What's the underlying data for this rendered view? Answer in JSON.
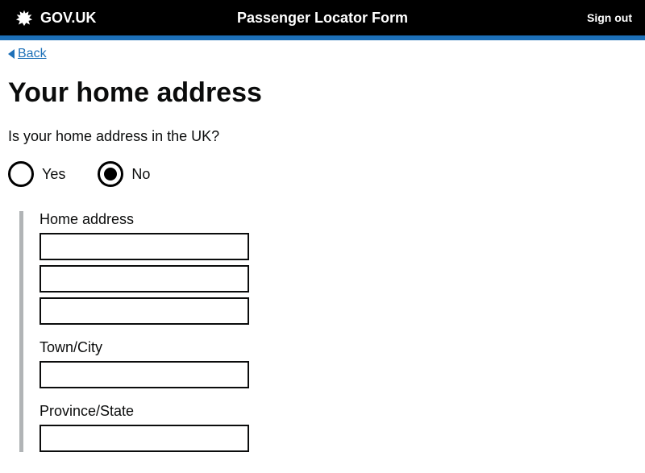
{
  "header": {
    "site_name": "GOV.UK",
    "service_title": "Passenger Locator Form",
    "sign_out": "Sign out"
  },
  "back": {
    "label": "Back"
  },
  "page": {
    "heading": "Your home address",
    "question": "Is your home address in the UK?"
  },
  "radios": {
    "yes": {
      "label": "Yes",
      "selected": false
    },
    "no": {
      "label": "No",
      "selected": true
    }
  },
  "fields": {
    "home_address": {
      "label": "Home address",
      "line1": "",
      "line2": "",
      "line3": ""
    },
    "town_city": {
      "label": "Town/City",
      "value": ""
    },
    "province_state": {
      "label": "Province/State",
      "value": ""
    }
  }
}
